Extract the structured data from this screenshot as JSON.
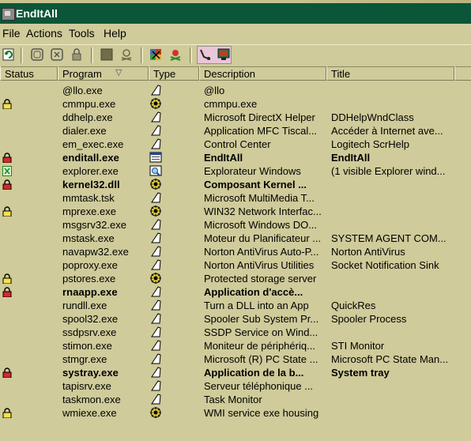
{
  "window": {
    "title": "EndItAll"
  },
  "menu": [
    "File",
    "Actions",
    "Tools",
    "Help"
  ],
  "columns": {
    "status": "Status",
    "program": "Program",
    "sort_indicator": "▽",
    "type": "Type",
    "description": "Description",
    "title": "Title"
  },
  "rows": [
    {
      "status": "",
      "program": "@llo.exe",
      "type": "page",
      "description": "@llo",
      "title": "",
      "bold": false
    },
    {
      "status": "lock-yellow",
      "program": "cmmpu.exe",
      "type": "gear",
      "description": "cmmpu.exe",
      "title": "",
      "bold": false
    },
    {
      "status": "",
      "program": "ddhelp.exe",
      "type": "page",
      "description": "Microsoft DirectX Helper",
      "title": "DDHelpWndClass",
      "bold": false
    },
    {
      "status": "",
      "program": "dialer.exe",
      "type": "page",
      "description": "Application MFC Tiscal...",
      "title": "Accéder à Internet ave...",
      "bold": false
    },
    {
      "status": "",
      "program": "em_exec.exe",
      "type": "page",
      "description": "Control Center",
      "title": "Logitech ScrHelp",
      "bold": false
    },
    {
      "status": "lock-red",
      "program": "enditall.exe",
      "type": "window",
      "description": "EndItAll",
      "title": "EndItAll",
      "bold": true
    },
    {
      "status": "green-x",
      "program": "explorer.exe",
      "type": "explorer",
      "description": "Explorateur Windows",
      "title": "(1 visible Explorer wind...",
      "bold": false
    },
    {
      "status": "lock-red",
      "program": "kernel32.dll",
      "type": "gear",
      "description": "Composant Kernel ...",
      "title": "",
      "bold": true
    },
    {
      "status": "",
      "program": "mmtask.tsk",
      "type": "page",
      "description": "Microsoft MultiMedia T...",
      "title": "",
      "bold": false
    },
    {
      "status": "lock-yellow",
      "program": "mprexe.exe",
      "type": "gear",
      "description": "WIN32 Network Interfac...",
      "title": "",
      "bold": false
    },
    {
      "status": "",
      "program": "msgsrv32.exe",
      "type": "page",
      "description": "Microsoft Windows DO...",
      "title": "",
      "bold": false
    },
    {
      "status": "",
      "program": "mstask.exe",
      "type": "page",
      "description": "Moteur du Planificateur ...",
      "title": "SYSTEM AGENT COM...",
      "bold": false
    },
    {
      "status": "",
      "program": "navapw32.exe",
      "type": "page",
      "description": "Norton AntiVirus Auto-P...",
      "title": "Norton AntiVirus",
      "bold": false
    },
    {
      "status": "",
      "program": "poproxy.exe",
      "type": "page",
      "description": "Norton AntiVirus Utilities",
      "title": "Socket Notification Sink",
      "bold": false
    },
    {
      "status": "lock-yellow",
      "program": "pstores.exe",
      "type": "gear",
      "description": "Protected storage server",
      "title": "",
      "bold": false
    },
    {
      "status": "lock-red",
      "program": "rnaapp.exe",
      "type": "page",
      "description": "Application d'accè...",
      "title": "",
      "bold": true
    },
    {
      "status": "",
      "program": "rundll.exe",
      "type": "page",
      "description": "Turn a DLL into an App",
      "title": "QuickRes",
      "bold": false
    },
    {
      "status": "",
      "program": "spool32.exe",
      "type": "page",
      "description": "Spooler Sub System Pr...",
      "title": "Spooler Process",
      "bold": false
    },
    {
      "status": "",
      "program": "ssdpsrv.exe",
      "type": "page",
      "description": "SSDP Service on Wind...",
      "title": "",
      "bold": false
    },
    {
      "status": "",
      "program": "stimon.exe",
      "type": "page",
      "description": "Moniteur de périphériq...",
      "title": "STI Monitor",
      "bold": false
    },
    {
      "status": "",
      "program": "stmgr.exe",
      "type": "page",
      "description": "Microsoft (R) PC State ...",
      "title": "Microsoft PC State Man...",
      "bold": false
    },
    {
      "status": "lock-red",
      "program": "systray.exe",
      "type": "page",
      "description": "Application de la b...",
      "title": "System tray",
      "bold": true
    },
    {
      "status": "",
      "program": "tapisrv.exe",
      "type": "page",
      "description": "Serveur téléphonique ...",
      "title": "",
      "bold": false
    },
    {
      "status": "",
      "program": "taskmon.exe",
      "type": "page",
      "description": "Task Monitor",
      "title": "",
      "bold": false
    },
    {
      "status": "lock-yellow",
      "program": "wmiexe.exe",
      "type": "gear",
      "description": "WMI service exe housing",
      "title": "",
      "bold": false
    }
  ],
  "colors": {
    "background": "#cfcb9a",
    "titlebar": "#0b5638",
    "pressed": "#e8c7d6"
  }
}
